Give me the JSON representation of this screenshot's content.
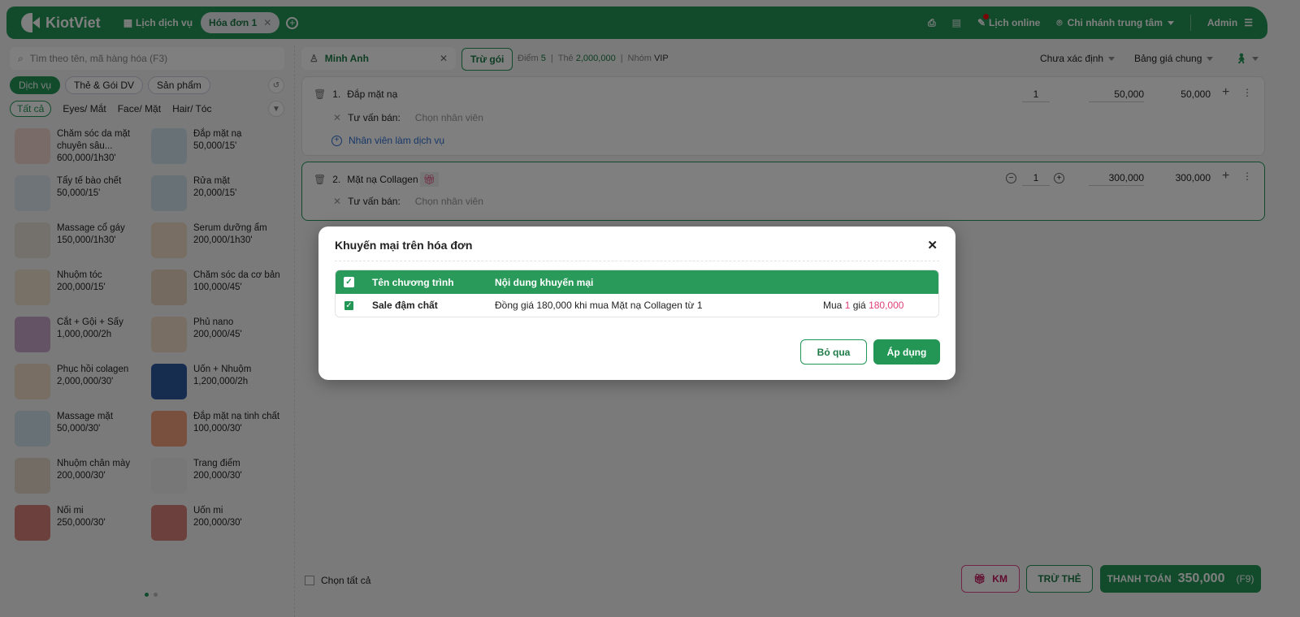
{
  "header": {
    "brand": "KiotViet",
    "nav_schedule": "Lịch dịch vụ",
    "active_tab": "Hóa đơn 1",
    "online_schedule": "Lịch online",
    "branch": "Chi nhánh trung tâm",
    "user": "Admin"
  },
  "left": {
    "search_placeholder": "Tìm theo tên, mã hàng hóa (F3)",
    "types": [
      "Dịch vụ",
      "Thẻ & Gói DV",
      "Sản phẩm"
    ],
    "categories": [
      "Tất cả",
      "Eyes/ Mắt",
      "Face/ Mặt",
      "Hair/ Tóc"
    ],
    "items": [
      {
        "name": "Chăm sóc da mặt chuyên sâu...",
        "price": "600,000/1h30'"
      },
      {
        "name": "Đắp mặt nạ",
        "price": "50,000/15'"
      },
      {
        "name": "Tẩy tế bào chết",
        "price": "50,000/15'"
      },
      {
        "name": "Rửa mặt",
        "price": "20,000/15'"
      },
      {
        "name": "Massage cổ gáy",
        "price": "150,000/1h30'"
      },
      {
        "name": "Serum dưỡng ẩm",
        "price": "200,000/1h30'"
      },
      {
        "name": "Nhuộm tóc",
        "price": "200,000/15'"
      },
      {
        "name": "Chăm sóc da cơ bản",
        "price": "100,000/45'"
      },
      {
        "name": "Cắt + Gội + Sấy",
        "price": "1,000,000/2h"
      },
      {
        "name": "Phủ nano",
        "price": "200,000/45'"
      },
      {
        "name": "Phục hồi colagen",
        "price": "2,000,000/30'"
      },
      {
        "name": "Uốn + Nhuộm",
        "price": "1,200,000/2h"
      },
      {
        "name": "Massage mặt",
        "price": "50,000/30'"
      },
      {
        "name": "Đắp mặt nạ tinh chất",
        "price": "100,000/30'"
      },
      {
        "name": "Nhuộm chân mày",
        "price": "200,000/30'"
      },
      {
        "name": "Trang điểm",
        "price": "200,000/30'"
      },
      {
        "name": "Nối mi",
        "price": "250,000/30'"
      },
      {
        "name": "Uốn mi",
        "price": "200,000/30'"
      }
    ]
  },
  "customer": {
    "name": "Minh Anh",
    "deduct_package": "Trừ gói",
    "points_label": "Điểm",
    "points": "5",
    "card_label": "Thẻ",
    "card": "2,000,000",
    "group_label": "Nhóm",
    "group": "VIP"
  },
  "selectors": {
    "status": "Chưa xác định",
    "price_list": "Bảng giá chung"
  },
  "lines": [
    {
      "index": "1.",
      "name": "Đắp mặt nạ",
      "qty": "1",
      "price": "50,000",
      "total": "50,000",
      "consultant_label": "Tư vấn bán:",
      "consultant_placeholder": "Chọn nhân viên",
      "staff_link": "Nhân viên làm dịch vụ"
    },
    {
      "index": "2.",
      "name": "Mặt nạ Collagen",
      "qty": "1",
      "price": "300,000",
      "total": "300,000",
      "consultant_label": "Tư vấn bán:",
      "consultant_placeholder": "Chọn nhân viên"
    }
  ],
  "footer": {
    "select_all": "Chọn tất cả",
    "km": "KM",
    "deduct_card": "TRỪ THẺ",
    "pay": "THANH TOÁN",
    "pay_amount": "350,000",
    "pay_key": "(F9)"
  },
  "modal": {
    "title": "Khuyến mại trên hóa đơn",
    "col_name": "Tên chương trình",
    "col_content": "Nội dung khuyến mại",
    "rows": [
      {
        "name": "Sale đậm chất",
        "content": "Đồng giá 180,000 khi mua Mặt nạ Collagen từ 1",
        "buy": "Mua",
        "buy_qty": "1",
        "price_word": "giá",
        "price": "180,000"
      }
    ],
    "skip": "Bỏ qua",
    "apply": "Áp dụng"
  },
  "colors": {
    "brand": "#239656",
    "promo": "#e0407a"
  }
}
